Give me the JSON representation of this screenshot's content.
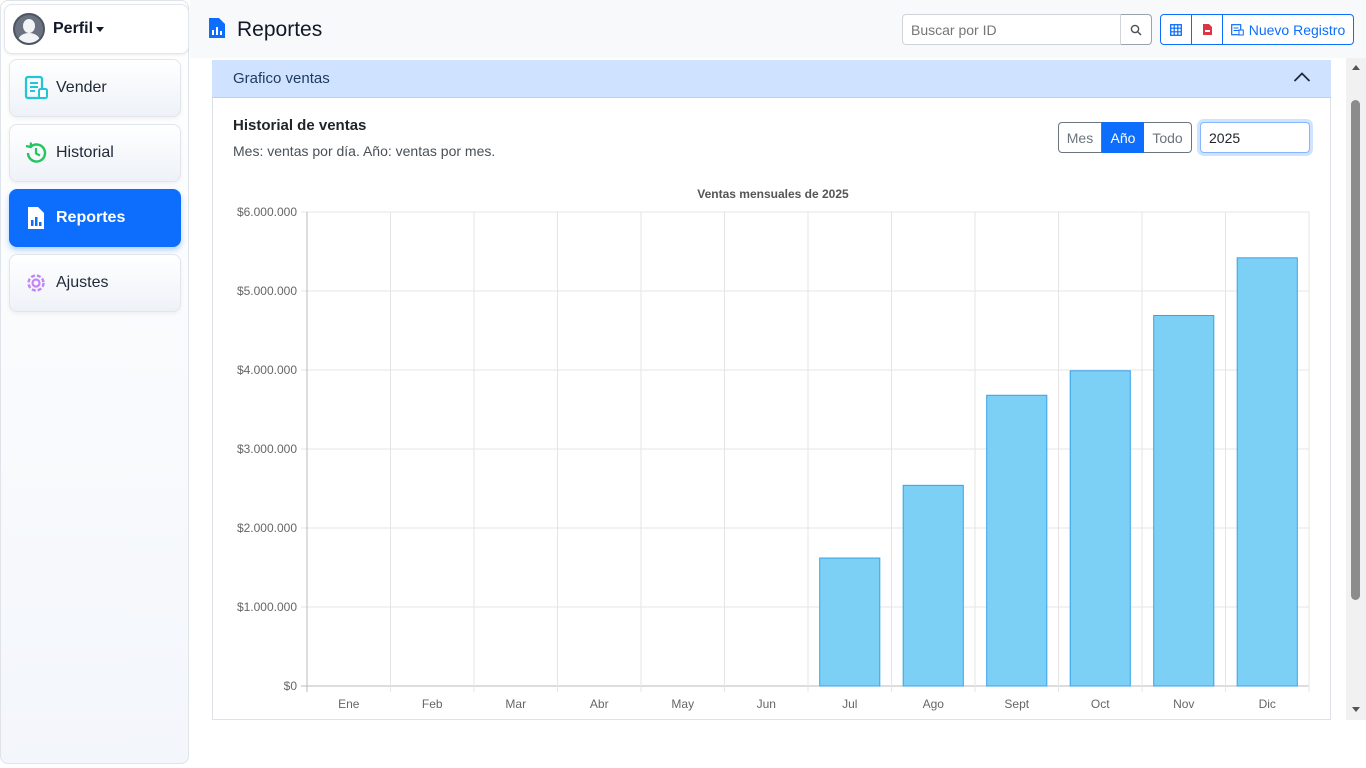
{
  "sidebar": {
    "profile_name": "Perfil",
    "items": [
      {
        "label": "Vender",
        "icon": "receipt-icon",
        "color": "#22c5d8"
      },
      {
        "label": "Historial",
        "icon": "history-icon",
        "color": "#22c55e"
      },
      {
        "label": "Reportes",
        "icon": "report-file-icon",
        "color": "#ffffff",
        "active": true
      },
      {
        "label": "Ajustes",
        "icon": "gear-icon",
        "color": "#c084fc"
      }
    ]
  },
  "header": {
    "title": "Reportes",
    "search_placeholder": "Buscar por ID",
    "new_record_label": "Nuevo Registro"
  },
  "accordion": {
    "title": "Grafico ventas"
  },
  "panel": {
    "title": "Historial de ventas",
    "subtitle": "Mes: ventas por día. Año: ventas por mes.",
    "periods": [
      "Mes",
      "Año",
      "Todo"
    ],
    "active_period": "Año",
    "year_value": "2025"
  },
  "chart_data": {
    "type": "bar",
    "title": "Ventas mensuales de 2025",
    "categories": [
      "Ene",
      "Feb",
      "Mar",
      "Abr",
      "May",
      "Jun",
      "Jul",
      "Ago",
      "Sept",
      "Oct",
      "Nov",
      "Dic"
    ],
    "values": [
      0,
      0,
      0,
      0,
      0,
      0,
      1620000,
      2540000,
      3680000,
      3990000,
      4690000,
      5420000
    ],
    "ylim": [
      0,
      6000000
    ],
    "yticks": [
      "$0",
      "$1.000.000",
      "$2.000.000",
      "$3.000.000",
      "$4.000.000",
      "$5.000.000",
      "$6.000.000"
    ],
    "bar_color": "#7dd0f5",
    "bar_border": "#36a2eb",
    "grid": true
  }
}
